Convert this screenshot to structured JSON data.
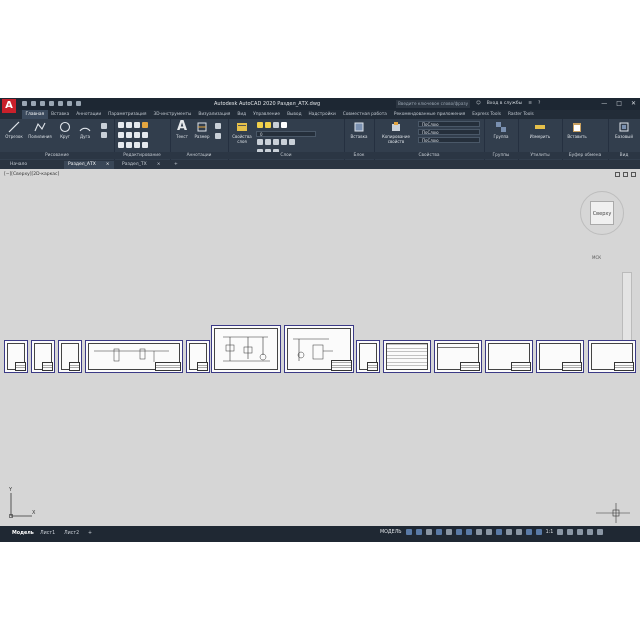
{
  "window": {
    "title": "Autodesk AutoCAD 2020   Раздел_АТХ.dwg",
    "search_placeholder": "Введите ключевое слово/фразу",
    "signin": "Вход в службы",
    "app_logo": "A"
  },
  "ribbon_tabs": [
    "Главная",
    "Вставка",
    "Аннотации",
    "Параметризация",
    "3D-инструменты",
    "Визуализация",
    "Вид",
    "Управление",
    "Вывод",
    "Надстройки",
    "Совместная работа",
    "Рекомендованные приложения",
    "Express Tools",
    "Raster Tools"
  ],
  "ribbon": {
    "draw": {
      "line": "Отрезок",
      "polyline": "Полилиния",
      "circle": "Круг",
      "arc": "Дуга",
      "title": "Рисование"
    },
    "modify": {
      "title": "Редактирование"
    },
    "annotation": {
      "text": "Текст",
      "dimension": "Размер",
      "title": "Аннотации"
    },
    "layers": {
      "props": "Свойства слоя",
      "title": "Слои"
    },
    "block": {
      "insert": "Вставка",
      "title": "Блок"
    },
    "properties": {
      "match": "Копирование свойств",
      "bylayer1": "ПоСлою",
      "bylayer2": "ПоСлою",
      "bylayer3": "ПоСлою",
      "title": "Свойства"
    },
    "groups": {
      "group": "Группа",
      "title": "Группы"
    },
    "utilities": {
      "measure": "Измерить",
      "title": "Утилиты"
    },
    "clipboard": {
      "paste": "Вставить",
      "title": "Буфер обмена"
    },
    "view": {
      "base": "Базовый",
      "title": "Вид"
    }
  },
  "doc_tabs": [
    "Начало",
    "Раздел_АТХ",
    "Раздел_ТХ"
  ],
  "viewport_label": "[−][Сверху][2D-каркас]",
  "viewcube": {
    "face": "Сверху",
    "wcs": "МСК"
  },
  "ucs_axes": {
    "x": "X",
    "y": "Y"
  },
  "layout_tabs": [
    "Модель",
    "Лист1",
    "Лист2"
  ],
  "status": {
    "model": "МОДЕЛЬ",
    "scale": "1:1"
  },
  "colors": {
    "accent": "#c8202b",
    "canvas": "#d6d6d6",
    "ui_dark": "#1b232e",
    "sheet_border": "#3b3a86"
  }
}
